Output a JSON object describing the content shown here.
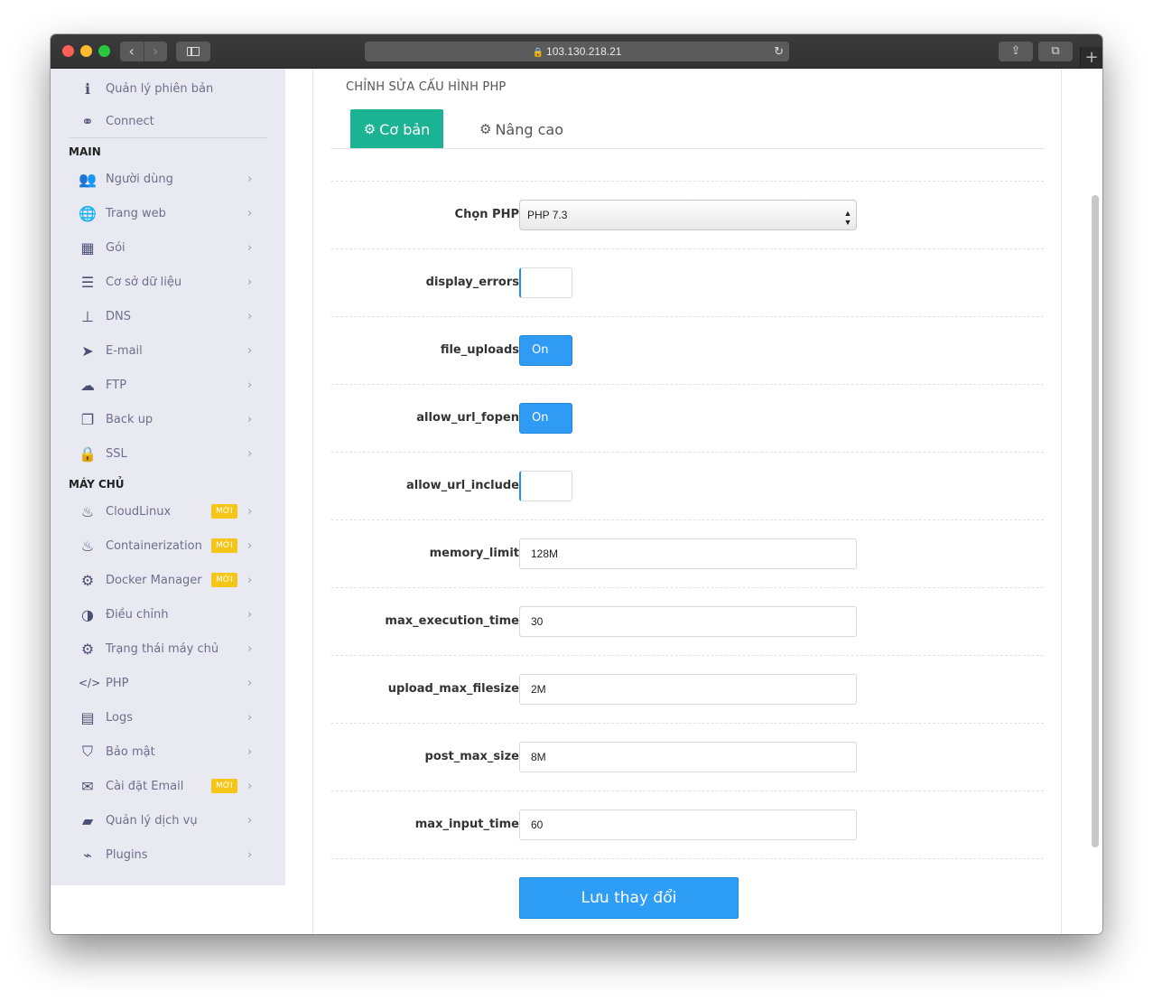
{
  "browser": {
    "url": "103.130.218.21",
    "lock_icon": "lock-icon",
    "reload_icon": "reload-icon"
  },
  "sidebar": {
    "top_items": [
      {
        "label": "Quản lý phiên bản",
        "icon": "info-icon"
      },
      {
        "label": "Connect",
        "icon": "link-icon"
      }
    ],
    "sections": [
      {
        "title": "MAIN",
        "items": [
          {
            "label": "Người dùng",
            "icon": "users-icon"
          },
          {
            "label": "Trang web",
            "icon": "globe-icon"
          },
          {
            "label": "Gói",
            "icon": "cubes-icon"
          },
          {
            "label": "Cơ sở dữ liệu",
            "icon": "database-icon"
          },
          {
            "label": "DNS",
            "icon": "sitemap-icon"
          },
          {
            "label": "E-mail",
            "icon": "paper-plane-icon"
          },
          {
            "label": "FTP",
            "icon": "cloud-upload-icon"
          },
          {
            "label": "Back up",
            "icon": "copy-icon"
          },
          {
            "label": "SSL",
            "icon": "lock-icon"
          }
        ]
      },
      {
        "title": "MÁY CHỦ",
        "items": [
          {
            "label": "CloudLinux",
            "icon": "fire-icon",
            "badge": "MỚI"
          },
          {
            "label": "Containerization",
            "icon": "fire-icon",
            "badge": "MỚI"
          },
          {
            "label": "Docker Manager",
            "icon": "cogs-icon",
            "badge": "MỚI"
          },
          {
            "label": "Điều chỉnh",
            "icon": "adjust-icon"
          },
          {
            "label": "Trạng thái máy chủ",
            "icon": "gear-icon"
          },
          {
            "label": "PHP",
            "icon": "code-icon"
          },
          {
            "label": "Logs",
            "icon": "file-icon"
          },
          {
            "label": "Bảo mật",
            "icon": "shield-icon"
          },
          {
            "label": "Cài đặt Email",
            "icon": "envelope-icon",
            "badge": "MỚI"
          },
          {
            "label": "Quản lý dịch vụ",
            "icon": "folder-open-icon"
          },
          {
            "label": "Plugins",
            "icon": "plug-icon"
          }
        ]
      }
    ]
  },
  "page": {
    "title": "CHỈNH SỬA CẤU HÌNH PHP",
    "tabs": [
      {
        "label": "Cơ bản",
        "icon": "gear-icon",
        "active": true
      },
      {
        "label": "Nâng cao",
        "icon": "cogs-icon",
        "active": false
      }
    ]
  },
  "form": {
    "php_select": {
      "label": "Chọn PHP",
      "value": "PHP 7.3"
    },
    "toggles": [
      {
        "label": "display_errors",
        "state": "off",
        "text": ""
      },
      {
        "label": "file_uploads",
        "state": "on",
        "text": "On"
      },
      {
        "label": "allow_url_fopen",
        "state": "on",
        "text": "On"
      },
      {
        "label": "allow_url_include",
        "state": "off",
        "text": ""
      }
    ],
    "inputs": [
      {
        "label": "memory_limit",
        "value": "128M"
      },
      {
        "label": "max_execution_time",
        "value": "30"
      },
      {
        "label": "upload_max_filesize",
        "value": "2M"
      },
      {
        "label": "post_max_size",
        "value": "8M"
      },
      {
        "label": "max_input_time",
        "value": "60"
      }
    ],
    "save_label": "Lưu thay đổi"
  },
  "colors": {
    "tab_active": "#1bb394",
    "primary": "#2e9df5",
    "badge": "#f5c518",
    "sidebar_bg": "#e9e9f2"
  }
}
